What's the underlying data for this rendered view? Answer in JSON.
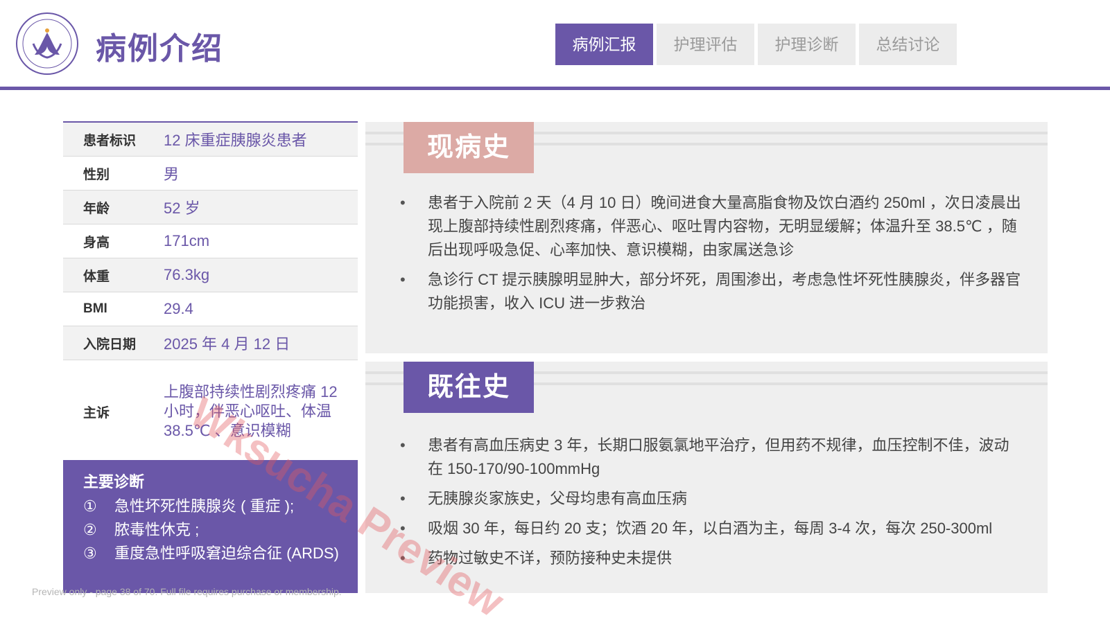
{
  "header": {
    "title": "病例介绍",
    "tabs": [
      {
        "label": "病例汇报",
        "active": true
      },
      {
        "label": "护理评估",
        "active": false
      },
      {
        "label": "护理诊断",
        "active": false
      },
      {
        "label": "总结讨论",
        "active": false
      }
    ]
  },
  "patient_info": [
    {
      "label": "患者标识",
      "value": "12 床重症胰腺炎患者"
    },
    {
      "label": "性别",
      "value": "男"
    },
    {
      "label": "年龄",
      "value": "52 岁"
    },
    {
      "label": "身高",
      "value": "171cm"
    },
    {
      "label": "体重",
      "value": "76.3kg"
    },
    {
      "label": "BMI",
      "value": "29.4"
    },
    {
      "label": "入院日期",
      "value": "2025 年 4 月 12 日"
    },
    {
      "label": "主诉",
      "value": "上腹部持续性剧烈疼痛 12 小时，伴恶心呕吐、体温 38.5℃ 、意识模糊"
    }
  ],
  "diagnosis": {
    "title": "主要诊断",
    "items": [
      {
        "num": "①",
        "text": "急性坏死性胰腺炎 ( 重症 );"
      },
      {
        "num": "②",
        "text": "脓毒性休克 ;"
      },
      {
        "num": "③",
        "text": "重度急性呼吸窘迫综合征 (ARDS)"
      }
    ]
  },
  "present_history": {
    "title": "现病史",
    "bullets": [
      "患者于入院前 2 天（4 月 10 日）晚间进食大量高脂食物及饮白酒约 250ml ，次日凌晨出现上腹部持续性剧烈疼痛，伴恶心、呕吐胃内容物，无明显缓解；体温升至 38.5℃ ，随后出现呼吸急促、心率加快、意识模糊，由家属送急诊",
      "急诊行 CT 提示胰腺明显肿大，部分坏死，周围渗出，考虑急性坏死性胰腺炎，伴多器官功能损害，收入 ICU 进一步救治"
    ]
  },
  "past_history": {
    "title": "既往史",
    "bullets": [
      "患者有高血压病史 3 年，长期口服氨氯地平治疗，但用药不规律，血压控制不佳，波动在 150-170/90-100mmHg",
      "无胰腺炎家族史，父母均患有高血压病",
      "吸烟 30 年，每日约 20 支；饮酒 20 年，以白酒为主，每周 3-4 次，每次 250-300ml",
      "药物过敏史不详，预防接种史未提供"
    ]
  },
  "watermark": "Wksucha Preview",
  "footer_note": "Preview only - page 38 of 70. Full file requires purchase or membership.",
  "colors": {
    "accent": "#6a57a8",
    "pink": "#dcaaa5",
    "panel": "#efefef"
  }
}
